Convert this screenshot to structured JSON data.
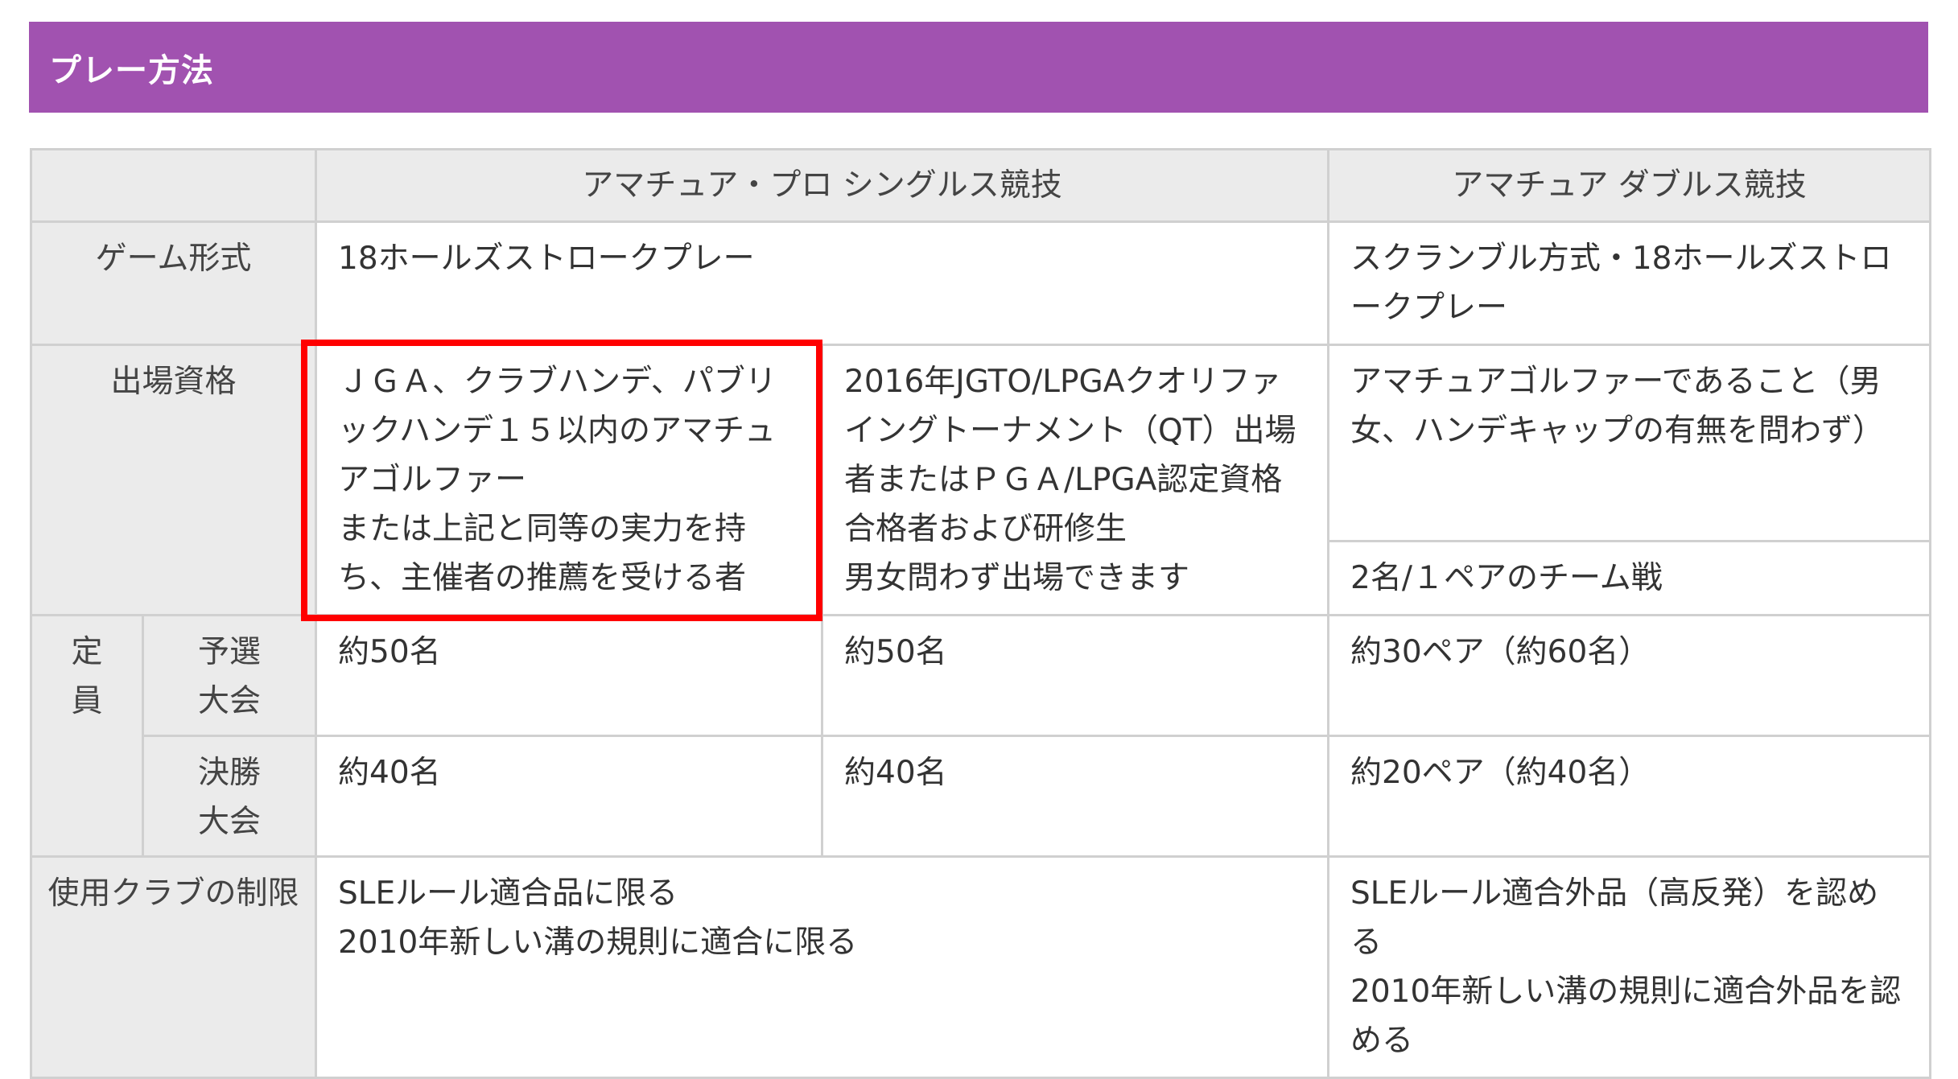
{
  "section": {
    "title": "プレー方法"
  },
  "table": {
    "headers": {
      "singles": "アマチュア・プロ シングルス競技",
      "doubles": "アマチュア ダブルス競技"
    },
    "game_format": {
      "label": "ゲーム形式",
      "singles": "18ホールズストロークプレー",
      "doubles": "スクランブル方式・18ホールズストロークプレー"
    },
    "eligibility": {
      "label": "出場資格",
      "amateur": "ＪＧＡ、クラブハンデ、パブリックハンデ１５以内のアマチュアゴルファー\nまたは上記と同等の実力を持ち、主催者の推薦を受ける者",
      "pro": "2016年JGTO/LPGAクオリファイングトーナメント（QT）出場者またはＰＧＡ/LPGA認定資格合格者および研修生\n男女問わず出場できます",
      "doubles": "アマチュアゴルファーであること（男女、ハンデキャップの有無を問わず）",
      "doubles_team": "2名/１ペアのチーム戦"
    },
    "capacity": {
      "label": "定員",
      "qualifier": {
        "label": "予選大会",
        "amateur": "約50名",
        "pro": "約50名",
        "doubles": "約30ペア（約60名）"
      },
      "final": {
        "label": "決勝大会",
        "amateur": "約40名",
        "pro": "約40名",
        "doubles": "約20ペア（約40名）"
      }
    },
    "club_rules": {
      "label": "使用クラブの制限",
      "singles": "SLEルール適合品に限る\n2010年新しい溝の規則に適合に限る",
      "doubles": "SLEルール適合外品（高反発）を認める\n2010年新しい溝の規則に適合外品を認める"
    }
  },
  "colors": {
    "header_bg": "#a152b0",
    "header_text": "#ffffff",
    "label_bg": "#ebebeb",
    "border": "#d0d0d0",
    "highlight": "#ff0000"
  }
}
